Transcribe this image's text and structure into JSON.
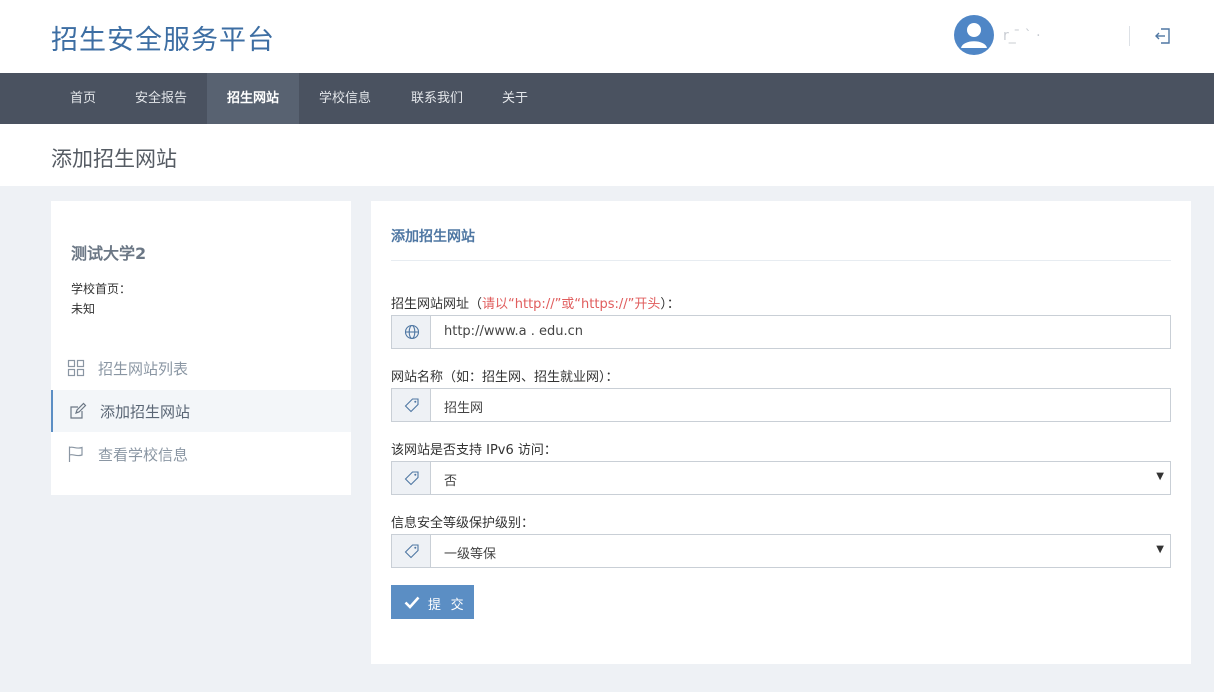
{
  "header": {
    "brand": "招生安全服务平台",
    "username": "r_  ̄  `  ·"
  },
  "nav": {
    "items": [
      {
        "label": "首页"
      },
      {
        "label": "安全报告"
      },
      {
        "label": "招生网站"
      },
      {
        "label": "学校信息"
      },
      {
        "label": "联系我们"
      },
      {
        "label": "关于"
      }
    ],
    "active_index": 2
  },
  "page": {
    "title": "添加招生网站"
  },
  "sidebar": {
    "school_name": "测试大学2",
    "home_label": "学校首页：",
    "home_value": "未知",
    "items": [
      {
        "label": "招生网站列表",
        "icon": "grid-icon"
      },
      {
        "label": "添加招生网站",
        "icon": "edit-icon"
      },
      {
        "label": "查看学校信息",
        "icon": "flag-icon"
      }
    ],
    "active_index": 1
  },
  "form": {
    "title": "添加招生网站",
    "url_label": "招生网站网址（",
    "url_hint": "请以“http://”或“https://”开头",
    "url_label_end": "）：",
    "url_value": "http://www.a  .  edu.cn",
    "name_label": "网站名称（如：招生网、招生就业网）：",
    "name_value": "招生网",
    "ipv6_label": "该网站是否支持 IPv6 访问：",
    "ipv6_value": "否",
    "level_label": "信息安全等级保护级别：",
    "level_value": "一级等保",
    "submit_label": "提 交"
  },
  "colors": {
    "brand": "#3d6ea3",
    "nav_bg": "#4a5260",
    "accent": "#5b8ec4",
    "hint": "#e05d5d"
  }
}
